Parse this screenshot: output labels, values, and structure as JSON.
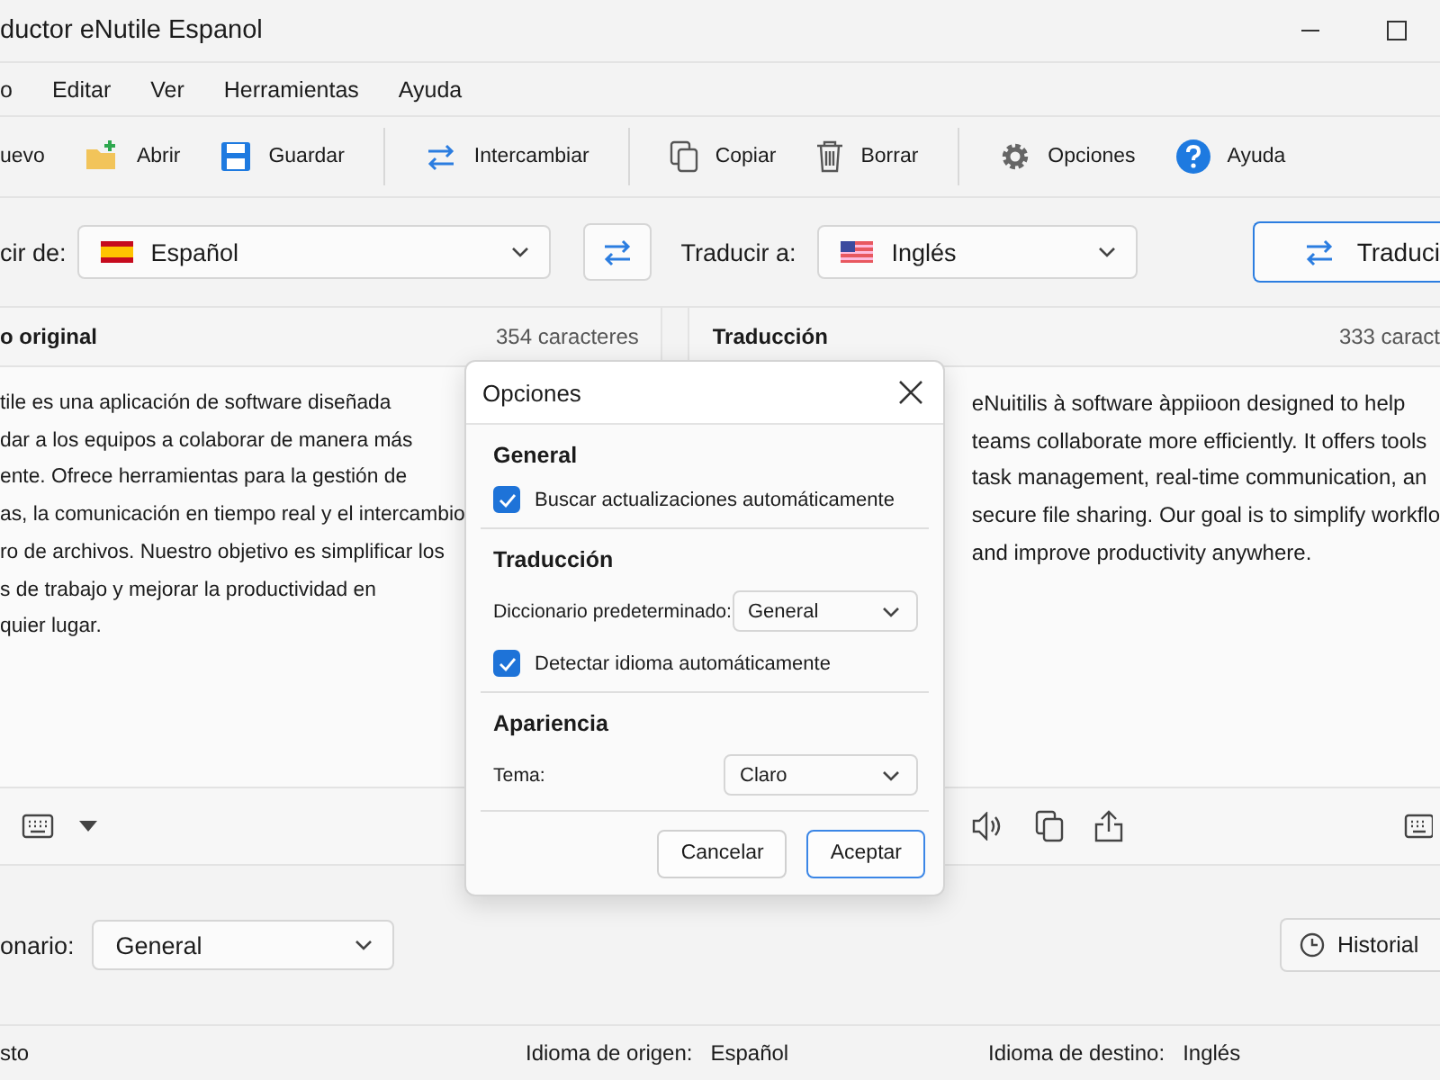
{
  "window": {
    "title": "ductor eNutile Espanol"
  },
  "menu": [
    "o",
    "Editar",
    "Ver",
    "Herramientas",
    "Ayuda"
  ],
  "toolbar": [
    {
      "kind": "new",
      "label": "uevo"
    },
    {
      "kind": "open",
      "label": "Abrir"
    },
    {
      "kind": "save",
      "label": "Guardar"
    },
    {
      "kind": "separator"
    },
    {
      "kind": "swap",
      "label": "Intercambiar"
    },
    {
      "kind": "separator"
    },
    {
      "kind": "copy",
      "label": "Copiar"
    },
    {
      "kind": "delete",
      "label": "Borrar"
    },
    {
      "kind": "separator"
    },
    {
      "kind": "settings",
      "label": "Opciones"
    },
    {
      "kind": "help",
      "label": "Ayuda"
    }
  ],
  "languages": {
    "source_label": "cir de:",
    "source": {
      "kind": "es",
      "name": "Español"
    },
    "target_label": "Traducir a:",
    "target": {
      "kind": "us",
      "name": "Inglés"
    },
    "translate_button": "Traduci"
  },
  "source_panel": {
    "title": "o original",
    "count": "354 caracteres",
    "lines": [
      "tile es una aplicación de software diseñada",
      "dar a los equipos a colaborar de manera más",
      "ente. Ofrece herramientas para la gestión de",
      "as, la comunicación en tiempo real y el intercambio",
      "ro de archivos. Nuestro objetivo es simplificar los",
      "s de trabajo y mejorar la productividad en",
      "quier lugar."
    ]
  },
  "target_panel": {
    "title": "Traducción",
    "count": "333 caract",
    "lines": [
      "eNuitilis à software àppiioon designed to help",
      "teams collaborate more efficiently. It offers tools",
      "task management, real-time communication, an",
      "secure file sharing. Our goal is to simplify workflo",
      "and improve productivity anywhere."
    ]
  },
  "dictionary": {
    "label": "onario:",
    "value": "General"
  },
  "history_button": "Historial",
  "status_bar": [
    {
      "label": "sto"
    },
    {
      "label": "Idioma de origen:",
      "value": "Español"
    },
    {
      "label": "Idioma de destino:",
      "value": "Inglés"
    }
  ],
  "dialog": {
    "title": "Opciones",
    "sections": [
      {
        "heading": "General",
        "items": [
          {
            "kind": "checkbox",
            "label": "Buscar actualizaciones automáticamente",
            "checked": true
          }
        ]
      },
      {
        "heading": "Traducción",
        "items": [
          {
            "kind": "select",
            "label": "Diccionario predeterminado:",
            "value": "General"
          },
          {
            "kind": "checkbox",
            "label": "Detectar idioma automáticamente",
            "checked": true
          }
        ]
      },
      {
        "heading": "Apariencia",
        "items": [
          {
            "kind": "select",
            "label": "Tema:",
            "value": "Claro"
          }
        ]
      }
    ],
    "buttons": [
      {
        "label": "Cancelar",
        "default": false
      },
      {
        "label": "Aceptar",
        "default": true
      }
    ]
  }
}
